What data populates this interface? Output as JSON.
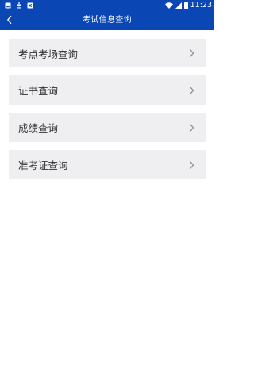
{
  "status_bar": {
    "time": "11:23",
    "icons": [
      "image-icon",
      "download-icon",
      "notification-icon",
      "wifi-icon",
      "signal-icon",
      "battery-icon"
    ]
  },
  "app_bar": {
    "title": "考试信息查询",
    "back_icon": "chevron-left-icon"
  },
  "menu": {
    "items": [
      {
        "label": "考点考场查询"
      },
      {
        "label": "证书查询"
      },
      {
        "label": "成绩查询"
      },
      {
        "label": "准考证查询"
      }
    ]
  },
  "colors": {
    "primary": "#0a46b4",
    "item_background": "#efeff1",
    "text": "#333333",
    "chevron": "#8a8a8a"
  }
}
